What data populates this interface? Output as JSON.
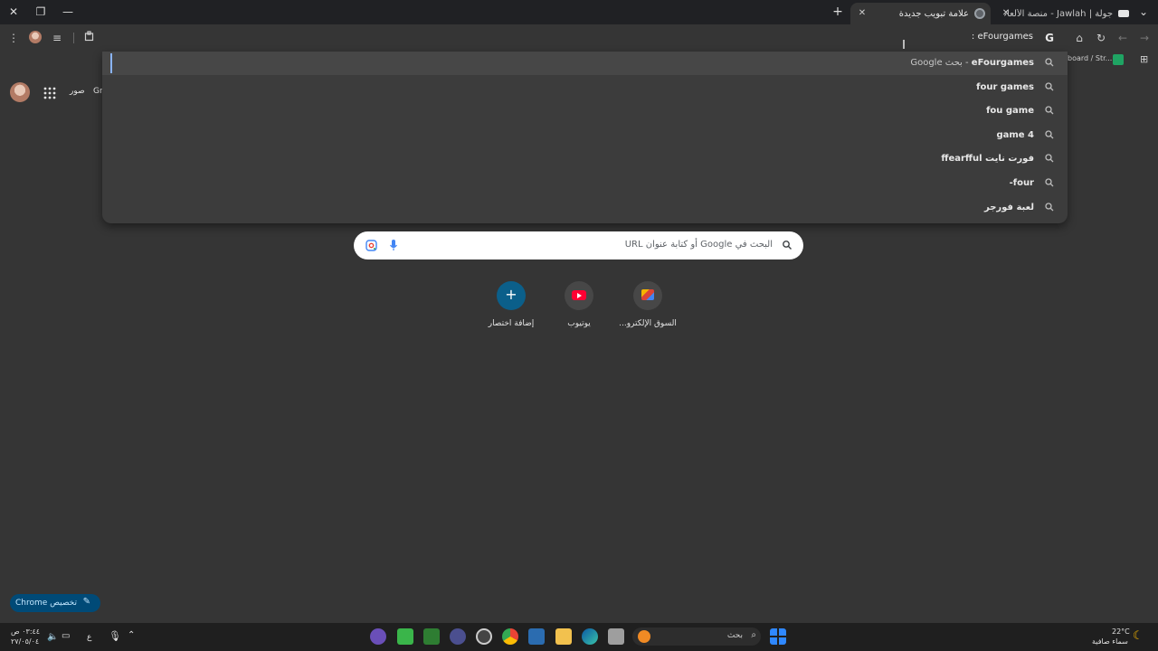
{
  "tabs": [
    {
      "title": "جولة | Jawlah - منصة الألعاب الـ",
      "active": false
    },
    {
      "title": "علامة تبويب جديدة",
      "active": true
    }
  ],
  "toolbar": {
    "omnibox_text": "eFourgames :"
  },
  "bookmarks": {
    "item_label": "board / Str..."
  },
  "suggestions": [
    {
      "bold": "eFourgames",
      "rest": " - بحث Google"
    },
    {
      "bold": "four games",
      "rest": ""
    },
    {
      "bold": "fou game",
      "rest": ""
    },
    {
      "bold": "4 game",
      "rest": ""
    },
    {
      "bold": "فورت نايت ffearfful",
      "rest": ""
    },
    {
      "bold": "four-",
      "rest": ""
    },
    {
      "bold": "لعبة فورجر",
      "rest": ""
    }
  ],
  "account": {
    "images_label": "صور",
    "gmail_label": "Gr"
  },
  "search": {
    "placeholder": "البحث في Google أو كتابة عنوان URL"
  },
  "shortcuts": [
    {
      "label": "السوق الإلكترو...",
      "icon": "store-icon"
    },
    {
      "label": "يوتيوب",
      "icon": "youtube-icon"
    },
    {
      "label": "إضافة اختصار",
      "icon": "plus-icon"
    }
  ],
  "customize": {
    "label": "تخصيص Chrome"
  },
  "taskbar": {
    "search_label": "بحث",
    "weather_temp": "22°C",
    "weather_desc": "سماء صافية",
    "time": "٠٣:٤٤ ص",
    "date": "٢٧/٠٥/٠٤",
    "lang": "ع"
  },
  "colors": {
    "page_bg": "#353535",
    "accent": "#8ab4f8",
    "customize_bg": "#004a77",
    "add_shortcut": "#0b5f8a",
    "youtube_red": "#ff0033"
  }
}
